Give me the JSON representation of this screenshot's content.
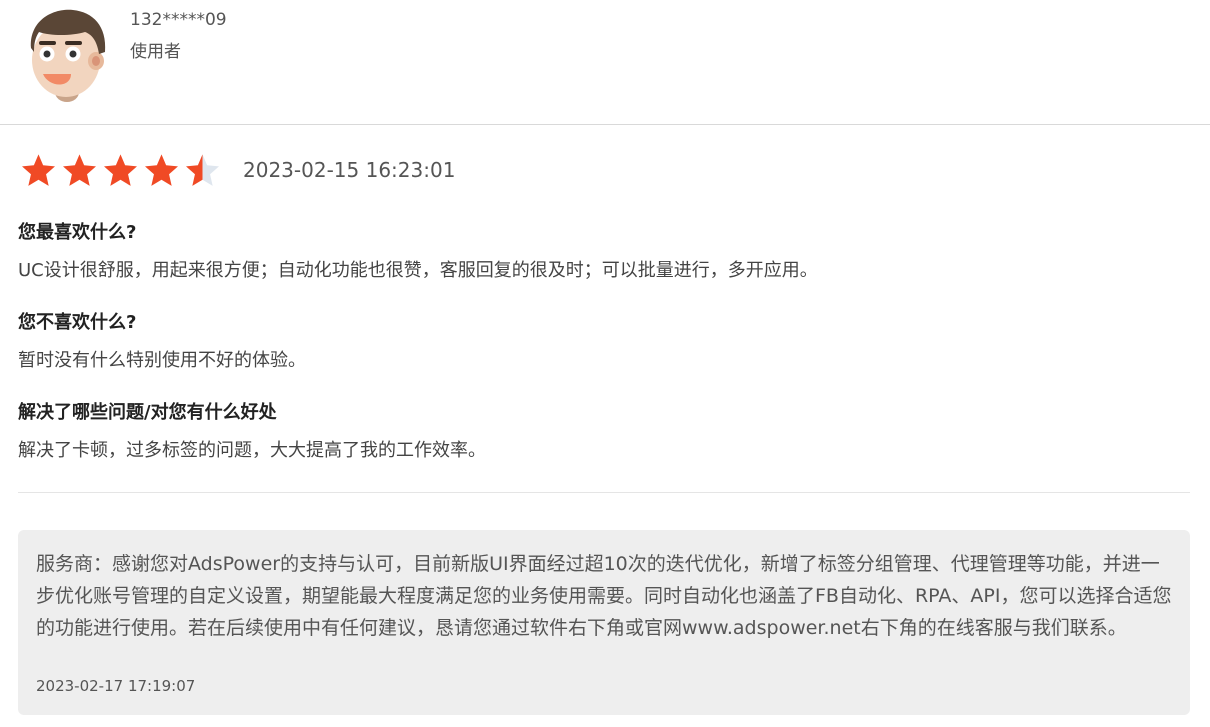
{
  "user": {
    "id": "132*****09",
    "role": "使用者"
  },
  "review": {
    "rating": 4.5,
    "max_rating": 5,
    "date": "2023-02-15 16:23:01",
    "sections": [
      {
        "question": "您最喜欢什么?",
        "answer": "UC设计很舒服，用起来很方便；自动化功能也很赞，客服回复的很及时；可以批量进行，多开应用。"
      },
      {
        "question": "您不喜欢什么?",
        "answer": "暂时没有什么特别使用不好的体验。"
      },
      {
        "question": "解决了哪些问题/对您有什么好处",
        "answer": "解决了卡顿，过多标签的问题，大大提高了我的工作效率。"
      }
    ]
  },
  "reply": {
    "text": "服务商：感谢您对AdsPower的支持与认可，目前新版UI界面经过超10次的迭代优化，新增了标签分组管理、代理管理等功能，并进一步优化账号管理的自定义设置，期望能最大程度满足您的业务使用需要。同时自动化也涵盖了FB自动化、RPA、API，您可以选择合适您的功能进行使用。若在后续使用中有任何建议，恳请您通过软件右下角或官网www.adspower.net右下角的在线客服与我们联系。",
    "date": "2023-02-17 17:19:07"
  },
  "colors": {
    "star_filled": "#f04a25",
    "star_empty": "#dfe6ee",
    "reply_bg": "#eeeeee"
  }
}
